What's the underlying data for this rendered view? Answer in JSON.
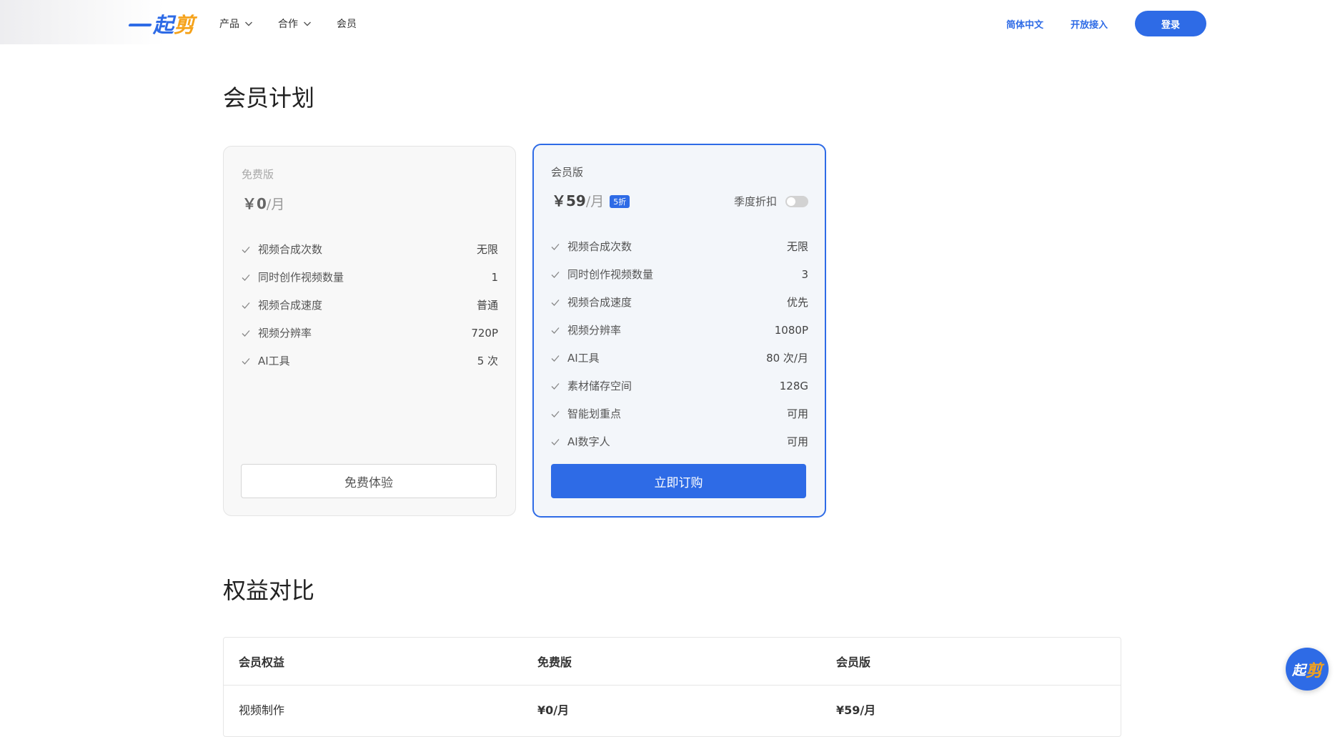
{
  "header": {
    "logo": {
      "part1": "起",
      "part2": "剪"
    },
    "nav": [
      {
        "label": "产品",
        "has_dropdown": true
      },
      {
        "label": "合作",
        "has_dropdown": true
      },
      {
        "label": "会员",
        "has_dropdown": false
      }
    ],
    "language_label": "简体中文",
    "open_access_label": "开放接入",
    "login_label": "登录"
  },
  "plans_section": {
    "title": "会员计划",
    "free": {
      "name": "免费版",
      "currency": "￥",
      "price": "0",
      "unit": "/月",
      "features": [
        {
          "name": "视频合成次数",
          "value": "无限"
        },
        {
          "name": "同时创作视频数量",
          "value": "1"
        },
        {
          "name": "视频合成速度",
          "value": "普通"
        },
        {
          "name": "视频分辨率",
          "value": "720P"
        },
        {
          "name": "AI工具",
          "value": "5 次"
        }
      ],
      "button_label": "免费体验"
    },
    "member": {
      "name": "会员版",
      "currency": "￥",
      "price": "59",
      "unit": "/月",
      "discount_badge": "5折",
      "quarterly_toggle_label": "季度折扣",
      "quarterly_toggle_on": false,
      "features": [
        {
          "name": "视频合成次数",
          "value": "无限"
        },
        {
          "name": "同时创作视频数量",
          "value": "3"
        },
        {
          "name": "视频合成速度",
          "value": "优先"
        },
        {
          "name": "视频分辨率",
          "value": "1080P"
        },
        {
          "name": "AI工具",
          "value": "80 次/月"
        },
        {
          "name": "素材储存空间",
          "value": "128G"
        },
        {
          "name": "智能划重点",
          "value": "可用"
        },
        {
          "name": "AI数字人",
          "value": "可用"
        }
      ],
      "button_label": "立即订购"
    }
  },
  "compare_section": {
    "title": "权益对比",
    "headers": [
      "会员权益",
      "免费版",
      "会员版"
    ],
    "rows": [
      [
        "视频制作",
        "¥0/月",
        "¥59/月"
      ]
    ]
  },
  "colors": {
    "accent": "#2e6be6",
    "logo_orange": "#f5a21a"
  },
  "icons": {
    "nav_dropdown": "chevron-down-icon",
    "feature_check": "check-icon"
  }
}
